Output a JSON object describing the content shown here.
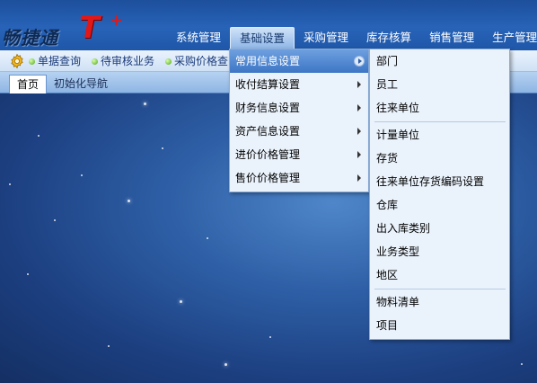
{
  "app": {
    "logo_text": "畅捷通",
    "logo_mark": "T",
    "logo_plus": "+"
  },
  "main_nav": [
    {
      "label": "系统管理",
      "active": false
    },
    {
      "label": "基础设置",
      "active": true
    },
    {
      "label": "采购管理",
      "active": false
    },
    {
      "label": "库存核算",
      "active": false
    },
    {
      "label": "销售管理",
      "active": false
    },
    {
      "label": "生产管理",
      "active": false
    }
  ],
  "quickbar": {
    "icon": "gear-icon",
    "items": [
      "单据查询",
      "待审核业务",
      "采购价格查"
    ]
  },
  "tabs": [
    {
      "label": "首页",
      "active": true
    },
    {
      "label": "初始化导航",
      "active": false
    }
  ],
  "submenu": [
    {
      "label": "常用信息设置",
      "active": true
    },
    {
      "label": "收付结算设置",
      "active": false
    },
    {
      "label": "财务信息设置",
      "active": false
    },
    {
      "label": "资产信息设置",
      "active": false
    },
    {
      "label": "进价价格管理",
      "active": false
    },
    {
      "label": "售价价格管理",
      "active": false
    }
  ],
  "flyout": {
    "groups": [
      [
        "部门",
        "员工",
        "往来单位"
      ],
      [
        "计量单位",
        "存货",
        "往来单位存货编码设置",
        "仓库",
        "出入库类别",
        "业务类型",
        "地区"
      ],
      [
        "物料清单",
        "项目"
      ]
    ]
  },
  "colors": {
    "header": "#2763b8",
    "menu_bg": "#eaf2fb",
    "menu_active": "#3d76c6",
    "logo_red": "#e01818"
  }
}
